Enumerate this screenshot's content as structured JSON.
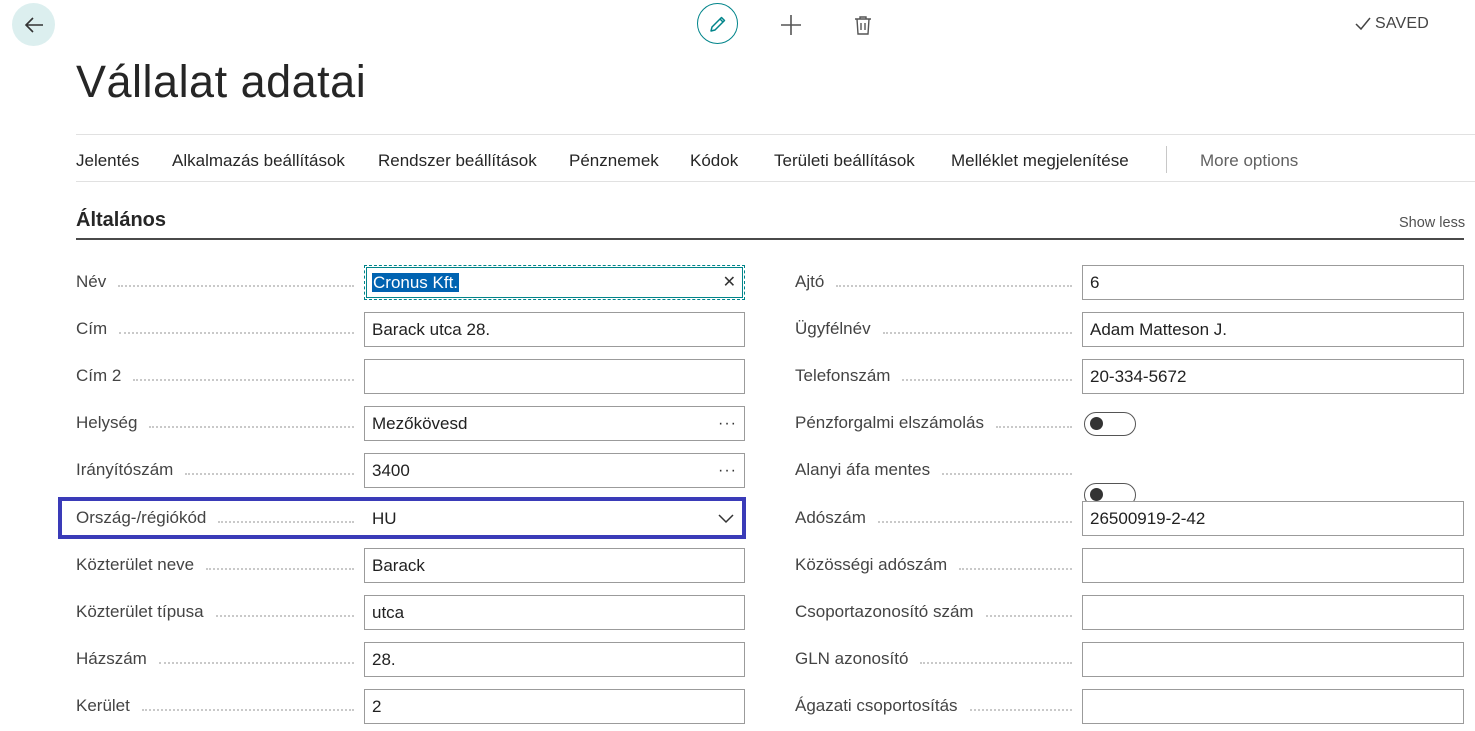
{
  "header": {
    "saved_label": "SAVED",
    "page_title": "Vállalat adatai"
  },
  "actions": [
    "Jelentés",
    "Alkalmazás beállítások",
    "Rendszer beállítások",
    "Pénznemek",
    "Kódok",
    "Területi beállítások",
    "Melléklet megjelenítése",
    "More options"
  ],
  "section": {
    "title": "Általános",
    "show_less": "Show less"
  },
  "left_fields": [
    {
      "label": "Név",
      "value": "Cronus Kft."
    },
    {
      "label": "Cím",
      "value": "Barack utca 28."
    },
    {
      "label": "Cím 2",
      "value": ""
    },
    {
      "label": "Helység",
      "value": "Mezőkövesd"
    },
    {
      "label": "Irányítószám",
      "value": "3400"
    },
    {
      "label": "Ország-/régiókód",
      "value": "HU"
    },
    {
      "label": "Közterület neve",
      "value": "Barack"
    },
    {
      "label": "Közterület típusa",
      "value": "utca"
    },
    {
      "label": "Házszám",
      "value": "28."
    },
    {
      "label": "Kerület",
      "value": "2"
    }
  ],
  "right_fields": [
    {
      "label": "Ajtó",
      "value": "6"
    },
    {
      "label": "Ügyfélnév",
      "value": "Adam Matteson J."
    },
    {
      "label": "Telefonszám",
      "value": "20-334-5672"
    },
    {
      "label": "Pénzforgalmi elszámolás",
      "value": "off"
    },
    {
      "label": "Alanyi áfa mentes",
      "value": "off"
    },
    {
      "label": "Adószám",
      "value": "26500919-2-42"
    },
    {
      "label": "Közösségi adószám",
      "value": ""
    },
    {
      "label": "Csoportazonosító szám",
      "value": ""
    },
    {
      "label": "GLN azonosító",
      "value": ""
    },
    {
      "label": "Ágazati csoportosítás",
      "value": ""
    }
  ],
  "colors": {
    "accent": "#00848a",
    "highlight": "#3a3bb8",
    "selection": "#0063b1"
  },
  "icons": [
    "back-arrow-icon",
    "pencil-icon",
    "plus-icon",
    "trash-icon",
    "checkmark-icon",
    "clear-icon",
    "ellipsis-icon",
    "chevron-down-icon"
  ]
}
